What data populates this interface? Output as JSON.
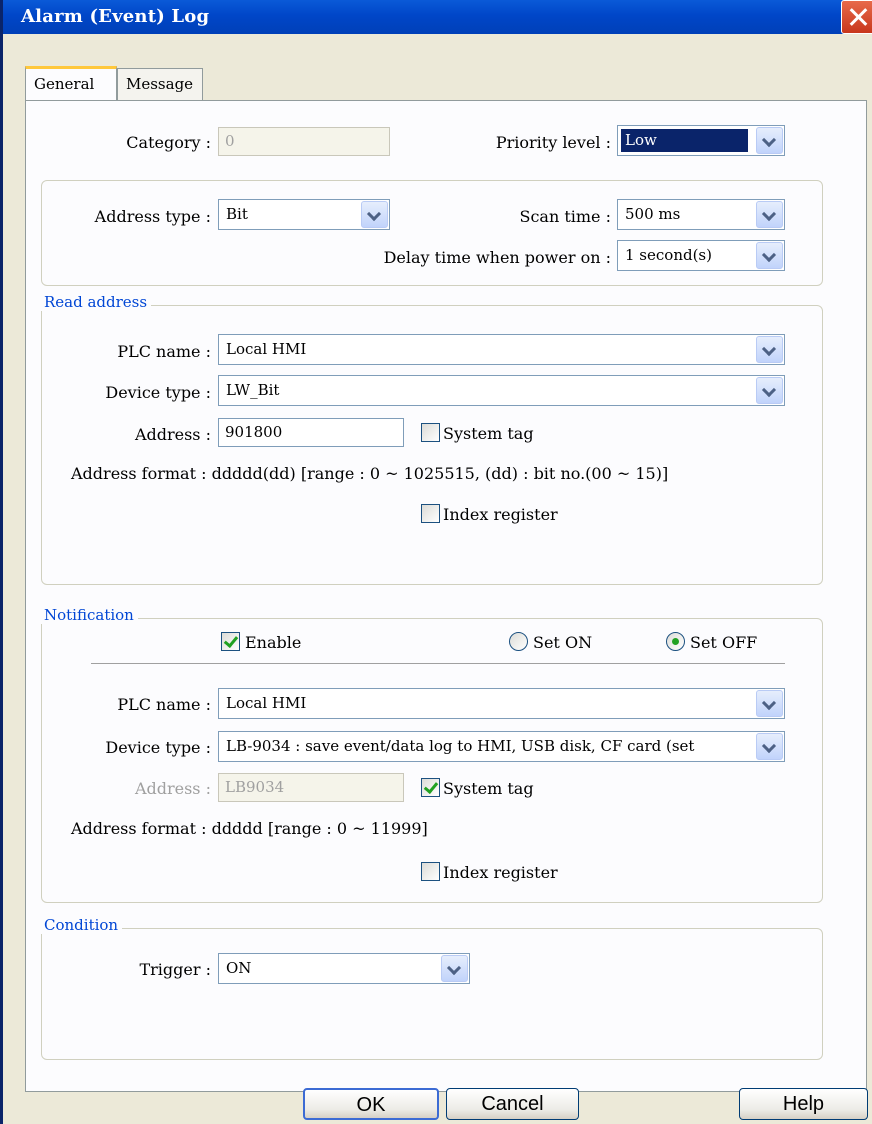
{
  "window": {
    "title": "Alarm (Event) Log"
  },
  "tabs": [
    {
      "label": "General"
    },
    {
      "label": "Message"
    }
  ],
  "general": {
    "category_label": "Category :",
    "category_value": "0",
    "priority_label": "Priority level :",
    "priority_value": "Low"
  },
  "scan": {
    "address_type_label": "Address type :",
    "address_type_value": "Bit",
    "scan_time_label": "Scan time :",
    "scan_time_value": "500 ms",
    "delay_label": "Delay time when power on :",
    "delay_value": "1 second(s)"
  },
  "read_address": {
    "title": "Read address",
    "plc_name_label": "PLC name :",
    "plc_name_value": "Local HMI",
    "device_type_label": "Device type :",
    "device_type_value": "LW_Bit",
    "address_label": "Address :",
    "address_value": "901800",
    "system_tag_label": "System tag",
    "system_tag_checked": false,
    "address_format": "Address format : ddddd(dd) [range : 0 ~ 1025515, (dd) : bit no.(00 ~ 15)]",
    "index_register_label": "Index register",
    "index_register_checked": false
  },
  "notification": {
    "title": "Notification",
    "enable_label": "Enable",
    "enable_checked": true,
    "set_on_label": "Set ON",
    "set_off_label": "Set OFF",
    "selected_mode": "Set OFF",
    "plc_name_label": "PLC name :",
    "plc_name_value": "Local HMI",
    "device_type_label": "Device type :",
    "device_type_value": "LB-9034 : save event/data log to HMI, USB disk, CF card (set",
    "address_label": "Address :",
    "address_value": "LB9034",
    "system_tag_label": "System tag",
    "system_tag_checked": true,
    "address_format": "Address format : ddddd [range : 0 ~ 11999]",
    "index_register_label": "Index register",
    "index_register_checked": false
  },
  "condition": {
    "title": "Condition",
    "trigger_label": "Trigger :",
    "trigger_value": "ON"
  },
  "buttons": {
    "ok": "OK",
    "cancel": "Cancel",
    "help": "Help"
  },
  "colors": {
    "titlebar": "#0046C8",
    "group_title": "#0046D5",
    "dialog_bg": "#ECE9D8",
    "check": "#21A121"
  }
}
